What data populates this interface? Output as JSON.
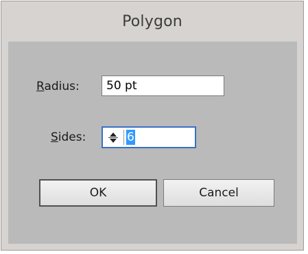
{
  "dialog": {
    "title": "Polygon",
    "radius": {
      "label_underlined": "R",
      "label_rest": "adius:",
      "value": "50 pt"
    },
    "sides": {
      "label_underlined": "S",
      "label_rest": "ides:",
      "value": "6",
      "spinner_icon": "up-down-spinner-icon"
    },
    "buttons": {
      "ok_label": "OK",
      "cancel_label": "Cancel"
    }
  }
}
